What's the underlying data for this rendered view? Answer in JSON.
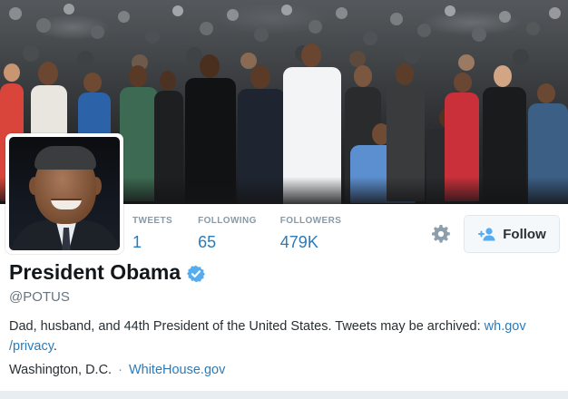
{
  "header": {
    "photo_description_icon": "crowd-photo"
  },
  "profile": {
    "name": "President Obama",
    "handle": "@POTUS",
    "verified_icon": "verified-badge-icon",
    "bio_text": "Dad, husband, and 44th President of the United States. Tweets may be archived: ",
    "bio_link_line1": "wh.gov",
    "bio_link_line2": "/privacy",
    "bio_end": ".",
    "location": "Washington, D.C.",
    "separator": "·",
    "website": "WhiteHouse.gov"
  },
  "stats": {
    "tweets_label": "TWEETS",
    "tweets_value": "1",
    "following_label": "FOLLOWING",
    "following_value": "65",
    "followers_label": "FOLLOWERS",
    "followers_value": "479K"
  },
  "actions": {
    "follow_label": "Follow",
    "settings_icon": "gear-icon",
    "follow_icon": "add-user-icon"
  },
  "colors": {
    "link": "#2b7bb9",
    "verified": "#55acee",
    "label": "#8899a6"
  }
}
